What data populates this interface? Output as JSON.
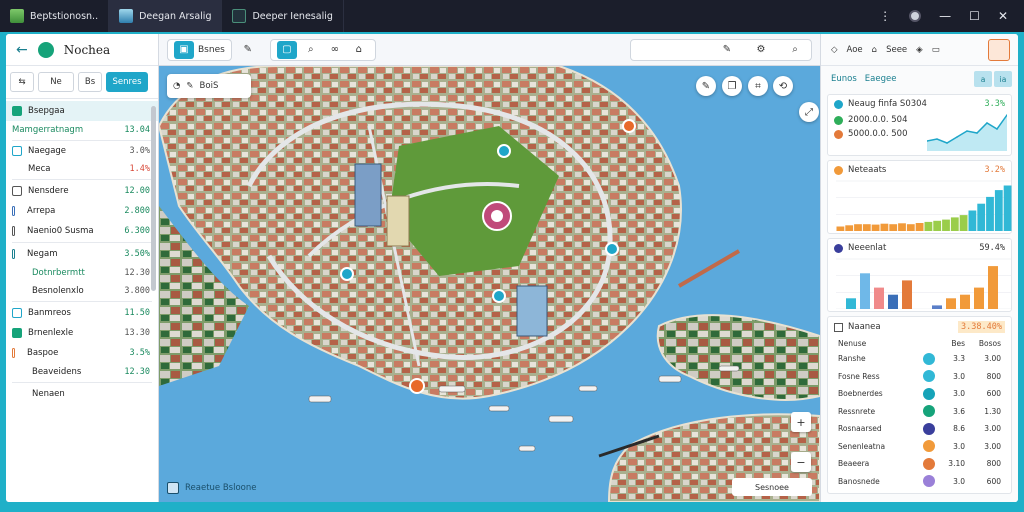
{
  "window": {
    "tabs": [
      {
        "label": "Beptstionosn.."
      },
      {
        "label": "Deegan Arsalig"
      },
      {
        "label": "Deeper Ienesalig"
      }
    ],
    "controls": {
      "minimize": "—",
      "maximize": "☐",
      "close": "✕"
    }
  },
  "left_panel": {
    "brand": "Nochea",
    "tools": [
      "Ne",
      "Bs",
      "Senres"
    ],
    "items": [
      {
        "label": "Bsepgaa",
        "value": ""
      },
      {
        "label": "Mamgerratnagm",
        "value": "13.04"
      },
      {
        "label": "Naegage",
        "value": "3.0%"
      },
      {
        "label": "Meca",
        "value": "1.4%"
      },
      {
        "label": "Nensdere",
        "value": "12.00"
      },
      {
        "label": "Arrepa",
        "value": "2.800"
      },
      {
        "label": "Naenio0 Susma",
        "value": "6.300"
      },
      {
        "label": "Negam",
        "value": "3.50%"
      },
      {
        "label": "Dotnrbermtt",
        "value": "12.30"
      },
      {
        "label": "Besnolenxlo",
        "value": "3.800"
      },
      {
        "label": "Banmreos",
        "value": "11.50"
      },
      {
        "label": "Brnenlexle",
        "value": "13.30"
      },
      {
        "label": "Baspoe",
        "value": "3.5%"
      },
      {
        "label": "Beaveidens",
        "value": "12.30"
      },
      {
        "label": "Nenaen",
        "value": ""
      }
    ]
  },
  "map": {
    "toolbar": {
      "layer_label": "Bsnes"
    },
    "search_chip": "BoiS",
    "footer": "Reaetue Bsloone",
    "scale": "Sesnoee",
    "zoom_in": "+",
    "zoom_out": "−"
  },
  "right_panel": {
    "top_label_1": "Aoe",
    "top_label_2": "Seee",
    "sub_label_1": "Eunos",
    "sub_label_2": "Eaegee",
    "sub_buttons": [
      "a",
      "ia"
    ],
    "card1": {
      "title": "Neaug finfa S0304",
      "title_value": "3.3%",
      "rows": [
        {
          "label": "2000.0.0. 504",
          "color": "#2fae5a"
        },
        {
          "label": "5000.0.0. 500",
          "color": "#e37a3a"
        }
      ]
    },
    "card2": {
      "title": "Neteaats",
      "title_value": "3.2%"
    },
    "card3": {
      "title": "Neeenlat",
      "title_value": "59.4%"
    },
    "table": {
      "title": "Naanea",
      "title_value": "3.38.40%",
      "headers": [
        "Nenuse",
        "Bes",
        "Bosos"
      ],
      "rows": [
        {
          "name": "Ranshe",
          "color": "#31b8d6",
          "v1": "3.3",
          "v2": "3.00"
        },
        {
          "name": "Fosne Ress",
          "color": "#31b8d6",
          "v1": "3.0",
          "v2": "800"
        },
        {
          "name": "Boebnerdes",
          "color": "#16a3b8",
          "v1": "3.0",
          "v2": "600"
        },
        {
          "name": "Ressnrete",
          "color": "#16a37a",
          "v1": "3.6",
          "v2": "1.30"
        },
        {
          "name": "Rosnaarsed",
          "color": "#3a3f9c",
          "v1": "8.6",
          "v2": "3.00"
        },
        {
          "name": "Senenleatna",
          "color": "#f19a3a",
          "v1": "3.0",
          "v2": "3.00"
        },
        {
          "name": "Beaeera",
          "color": "#e37a3a",
          "v1": "3.10",
          "v2": "800"
        },
        {
          "name": "Banosnede",
          "color": "#9a80d8",
          "v1": "3.0",
          "v2": "600"
        }
      ]
    }
  },
  "chart_data": [
    {
      "type": "area",
      "title": "Neaug finfa S0304",
      "x": [
        0,
        1,
        2,
        3,
        4,
        5,
        6,
        7,
        8
      ],
      "series": [
        {
          "values": [
            5,
            6,
            4,
            7,
            10,
            9,
            14,
            11,
            18
          ]
        }
      ],
      "ylim": [
        0,
        20
      ]
    },
    {
      "type": "bar",
      "title": "Neteaats",
      "categories": [
        "1",
        "2",
        "3",
        "4",
        "5",
        "6",
        "7",
        "8",
        "9",
        "10",
        "11",
        "12",
        "13",
        "14",
        "15",
        "16",
        "17",
        "18",
        "19",
        "20"
      ],
      "values": [
        2,
        2.5,
        3,
        3,
        2.8,
        3.2,
        3,
        3.4,
        3,
        3.5,
        4,
        4.5,
        5,
        6,
        7,
        9,
        12,
        15,
        18,
        20
      ],
      "ylim": [
        0,
        22
      ]
    },
    {
      "type": "bar",
      "title": "Neeenlat",
      "categories": [
        "1",
        "2",
        "3",
        "4",
        "5",
        "6",
        "7",
        "8",
        "9",
        "10"
      ],
      "values": [
        3,
        10,
        6,
        4,
        8,
        1,
        3,
        4,
        6,
        12
      ],
      "ylim": [
        0,
        14
      ]
    }
  ]
}
